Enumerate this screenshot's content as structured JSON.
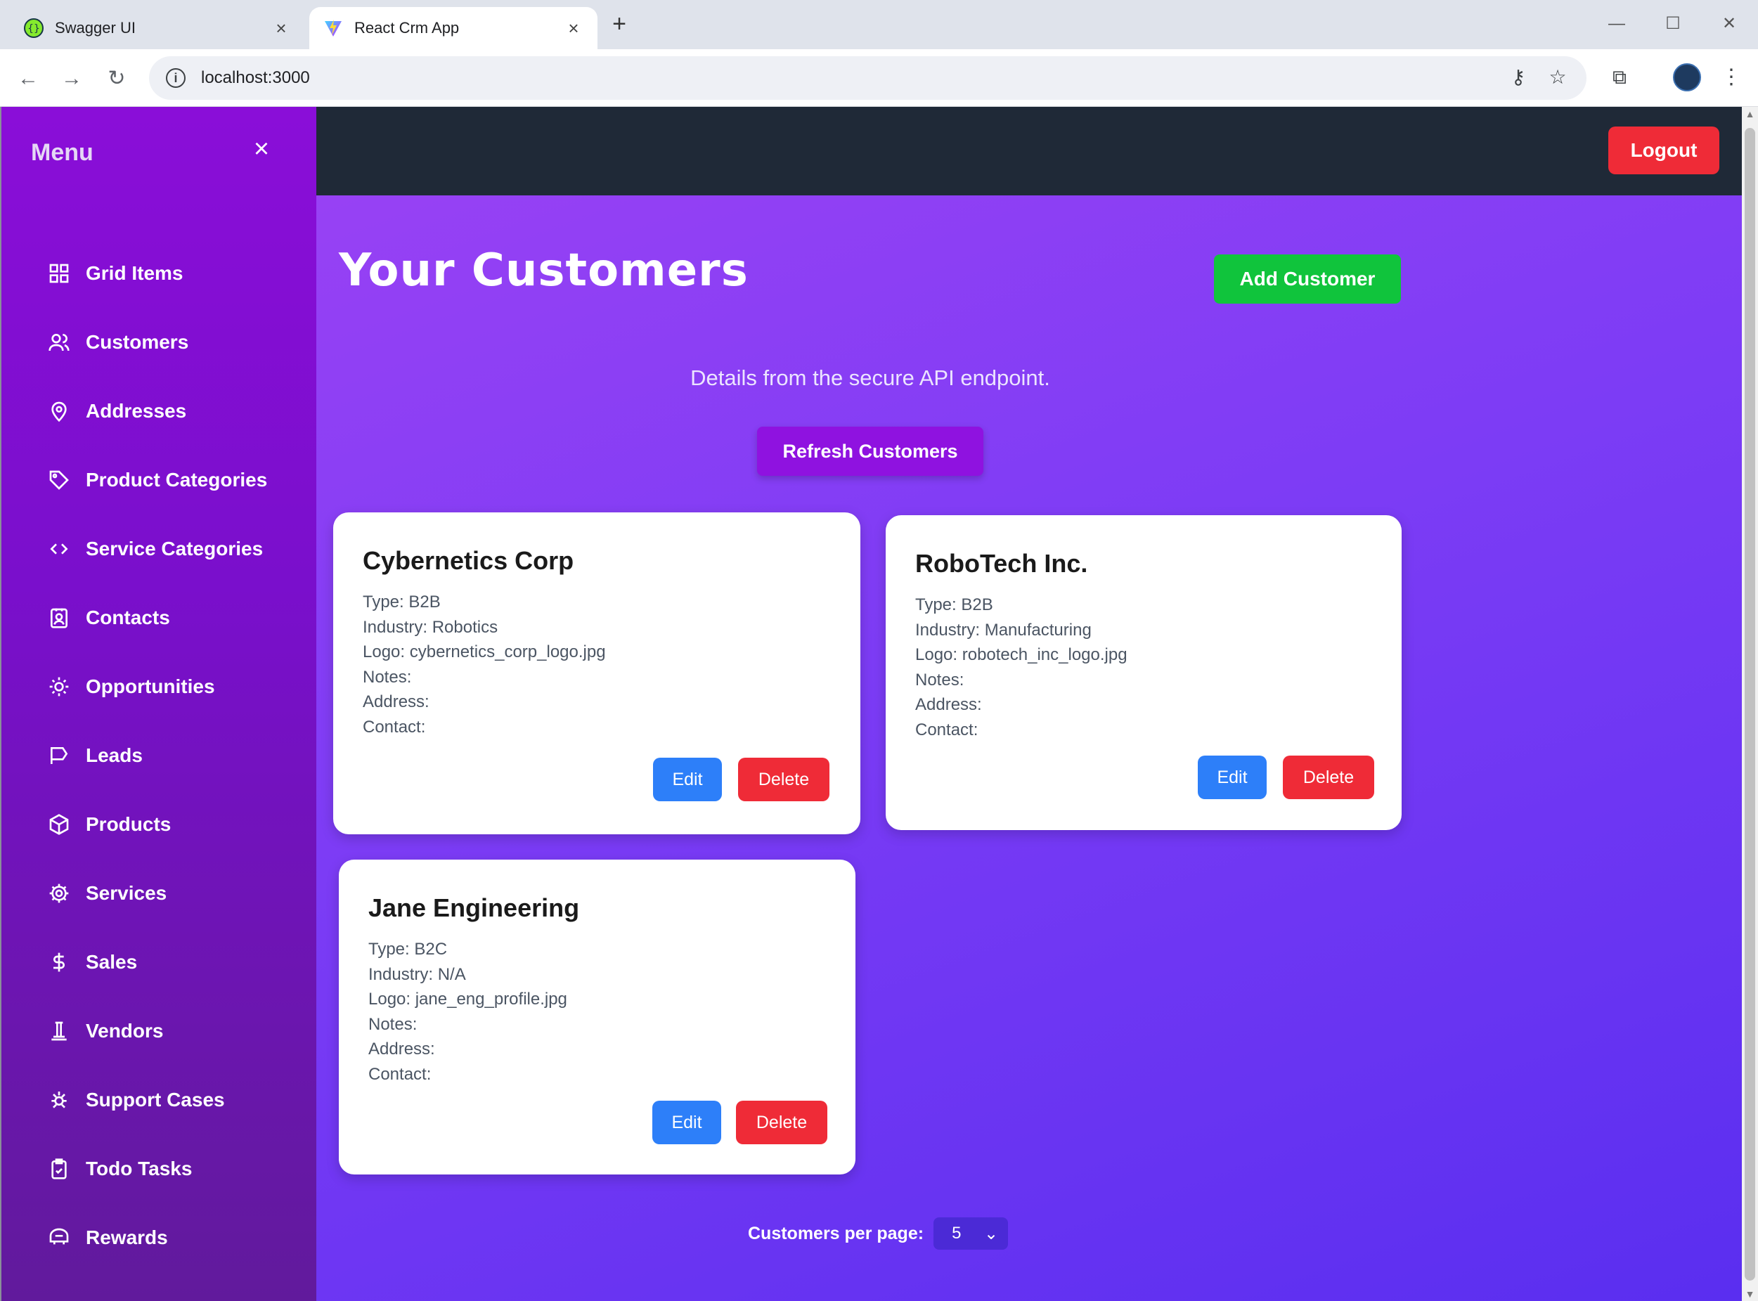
{
  "browser": {
    "tabs": [
      {
        "title": "Swagger UI",
        "favicon": "swagger-icon",
        "active": false
      },
      {
        "title": "React Crm App",
        "favicon": "vite-icon",
        "active": true
      }
    ],
    "url": "localhost:3000"
  },
  "sidebar": {
    "title": "Menu",
    "items": [
      {
        "label": "Grid Items",
        "icon": "grid-icon"
      },
      {
        "label": "Customers",
        "icon": "users-icon"
      },
      {
        "label": "Addresses",
        "icon": "map-pin-icon"
      },
      {
        "label": "Product Categories",
        "icon": "tag-icon"
      },
      {
        "label": "Service Categories",
        "icon": "code-icon"
      },
      {
        "label": "Contacts",
        "icon": "contact-icon"
      },
      {
        "label": "Opportunities",
        "icon": "sun-icon"
      },
      {
        "label": "Leads",
        "icon": "flag-icon"
      },
      {
        "label": "Products",
        "icon": "box-icon"
      },
      {
        "label": "Services",
        "icon": "cog-icon"
      },
      {
        "label": "Sales",
        "icon": "dollar-icon"
      },
      {
        "label": "Vendors",
        "icon": "vendor-icon"
      },
      {
        "label": "Support Cases",
        "icon": "bug-icon"
      },
      {
        "label": "Todo Tasks",
        "icon": "clipboard-check-icon"
      },
      {
        "label": "Rewards",
        "icon": "reward-icon"
      }
    ]
  },
  "header": {
    "logout_label": "Logout"
  },
  "page": {
    "title": "Your Customers",
    "add_label": "Add Customer",
    "subtitle": "Details from the secure API endpoint.",
    "refresh_label": "Refresh Customers"
  },
  "customers": [
    {
      "name": "Cybernetics Corp",
      "type": "Type: B2B",
      "industry": "Industry: Robotics",
      "logo": "Logo: cybernetics_corp_logo.jpg",
      "notes": "Notes:",
      "address": "Address:",
      "contact": "Contact:",
      "edit_label": "Edit",
      "delete_label": "Delete"
    },
    {
      "name": "RoboTech Inc.",
      "type": "Type: B2B",
      "industry": "Industry: Manufacturing",
      "logo": "Logo: robotech_inc_logo.jpg",
      "notes": "Notes:",
      "address": "Address:",
      "contact": "Contact:",
      "edit_label": "Edit",
      "delete_label": "Delete"
    },
    {
      "name": "Jane Engineering",
      "type": "Type: B2C",
      "industry": "Industry: N/A",
      "logo": "Logo: jane_eng_profile.jpg",
      "notes": "Notes:",
      "address": "Address:",
      "contact": "Contact:",
      "edit_label": "Edit",
      "delete_label": "Delete"
    }
  ],
  "pagination": {
    "label": "Customers per page:",
    "value": "5"
  },
  "colors": {
    "sidebar": "#8a0ed8",
    "topbar": "#1f2937",
    "logout": "#ef2b37",
    "add": "#10c43c",
    "refresh": "#8f12e0",
    "edit": "#2d7ff9",
    "delete": "#ef2b37"
  }
}
